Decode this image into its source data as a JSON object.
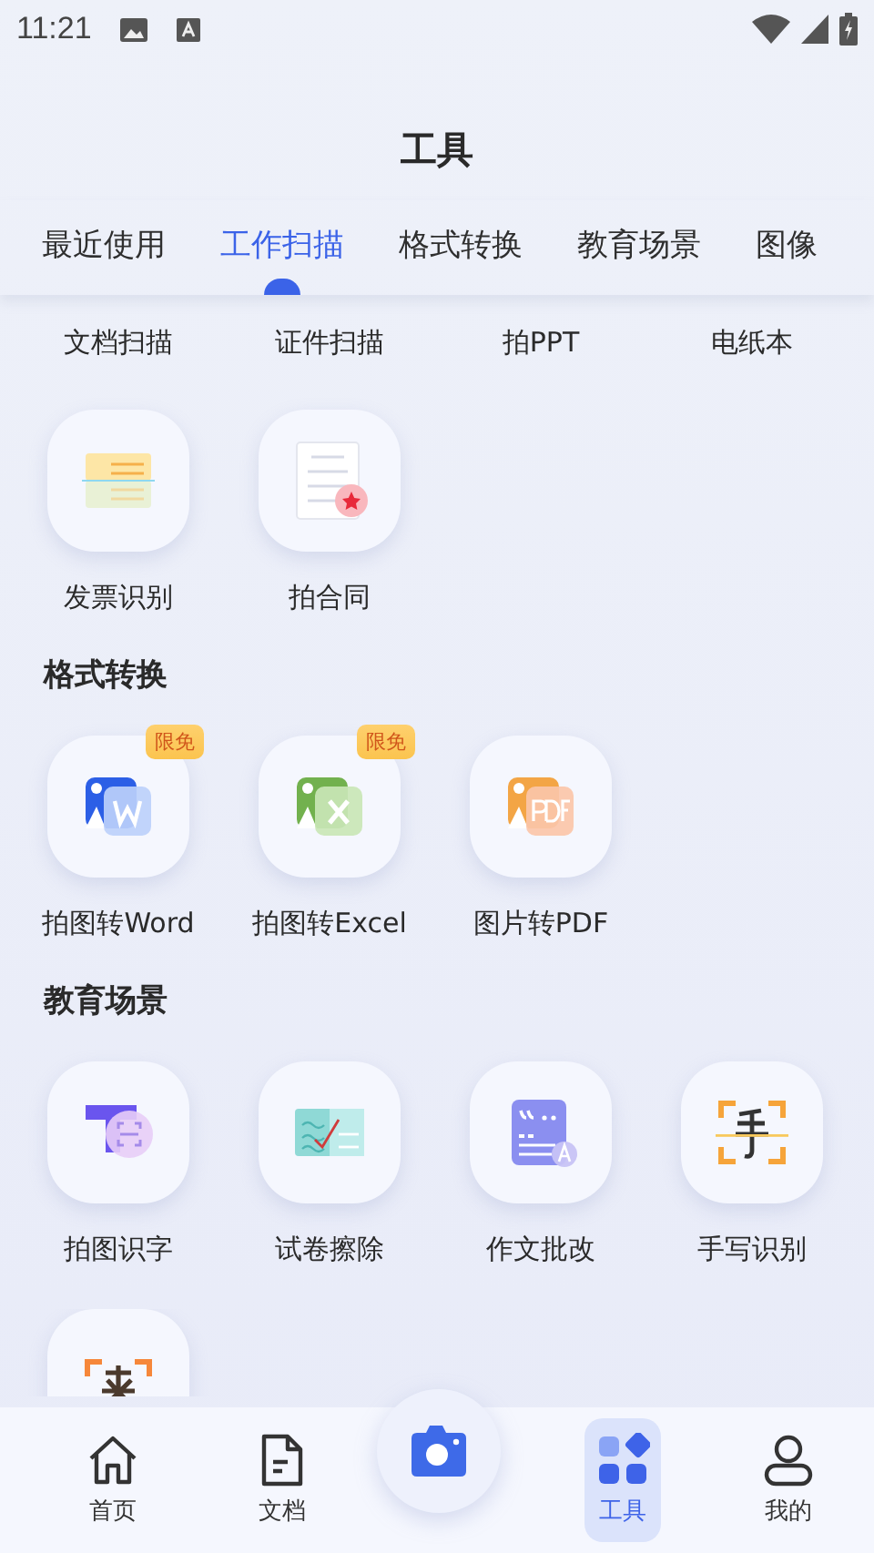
{
  "status_bar": {
    "time": "11:21"
  },
  "title": "工具",
  "tabs": [
    {
      "label": "最近使用",
      "selected": false
    },
    {
      "label": "工作扫描",
      "selected": true
    },
    {
      "label": "格式转换",
      "selected": false
    },
    {
      "label": "教育场景",
      "selected": false
    },
    {
      "label": "图像",
      "selected": false
    }
  ],
  "sections": [
    {
      "tools": [
        {
          "label": "文档扫描",
          "kind": "label_only"
        },
        {
          "label": "证件扫描",
          "kind": "label_only"
        },
        {
          "label": "拍PPT",
          "kind": "label_only"
        },
        {
          "label": "电纸本",
          "kind": "label_only"
        },
        {
          "label": "发票识别",
          "kind": "tool"
        },
        {
          "label": "拍合同",
          "kind": "tool"
        }
      ]
    },
    {
      "heading": "格式转换",
      "tools": [
        {
          "label": "拍图转Word",
          "kind": "tool",
          "badge": "限免"
        },
        {
          "label": "拍图转Excel",
          "kind": "tool",
          "badge": "限免"
        },
        {
          "label": "图片转PDF",
          "kind": "tool"
        }
      ]
    },
    {
      "heading": "教育场景",
      "tools": [
        {
          "label": "拍图识字",
          "kind": "tool"
        },
        {
          "label": "试卷擦除",
          "kind": "tool"
        },
        {
          "label": "作文批改",
          "kind": "tool"
        },
        {
          "label": "手写识别",
          "kind": "tool"
        },
        {
          "kind": "cut"
        }
      ]
    }
  ],
  "nav": [
    {
      "label": "首页",
      "selected": false
    },
    {
      "label": "文档",
      "selected": false
    },
    {
      "label": "工具",
      "selected": true
    },
    {
      "label": "我的",
      "selected": false
    }
  ]
}
